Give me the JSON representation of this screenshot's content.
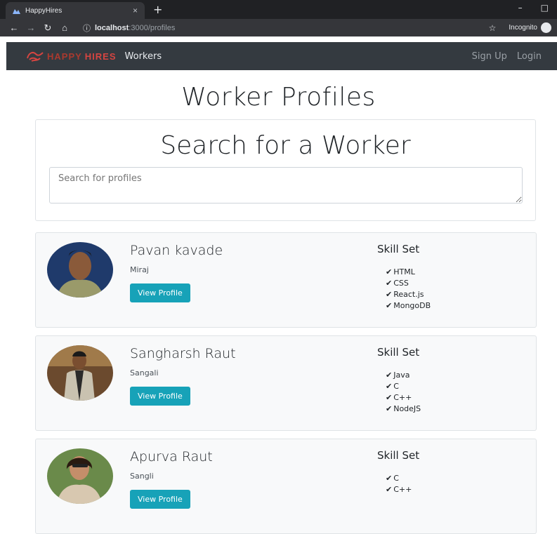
{
  "browser": {
    "tab_title": "HappyHires",
    "tab_close": "×",
    "new_tab": "+",
    "url_host": "localhost",
    "url_path": ":3000/profiles",
    "incognito_label": "Incognito",
    "win_min": "–",
    "win_max": "□"
  },
  "nav": {
    "brand_happy": "HAPPY",
    "brand_hires": "HIRES",
    "workers": "Workers",
    "signup": "Sign Up",
    "login": "Login"
  },
  "page": {
    "title": "Worker Profiles",
    "search_heading": "Search for a Worker",
    "search_placeholder": "Search for profiles"
  },
  "profiles": [
    {
      "name": "Pavan kavade",
      "location": "Miraj",
      "button": "View Profile",
      "skills_heading": "Skill Set",
      "skills": [
        "HTML",
        "CSS",
        "React.js",
        "MongoDB"
      ]
    },
    {
      "name": "Sangharsh Raut",
      "location": "Sangali",
      "button": "View Profile",
      "skills_heading": "Skill Set",
      "skills": [
        "Java",
        "C",
        "C++",
        "NodeJS"
      ]
    },
    {
      "name": "Apurva Raut",
      "location": "Sangli",
      "button": "View Profile",
      "skills_heading": "Skill Set",
      "skills": [
        "C",
        "C++"
      ]
    }
  ],
  "colors": {
    "accent": "#17a2b8",
    "navbar": "#343a40",
    "brand": "#d64541"
  }
}
